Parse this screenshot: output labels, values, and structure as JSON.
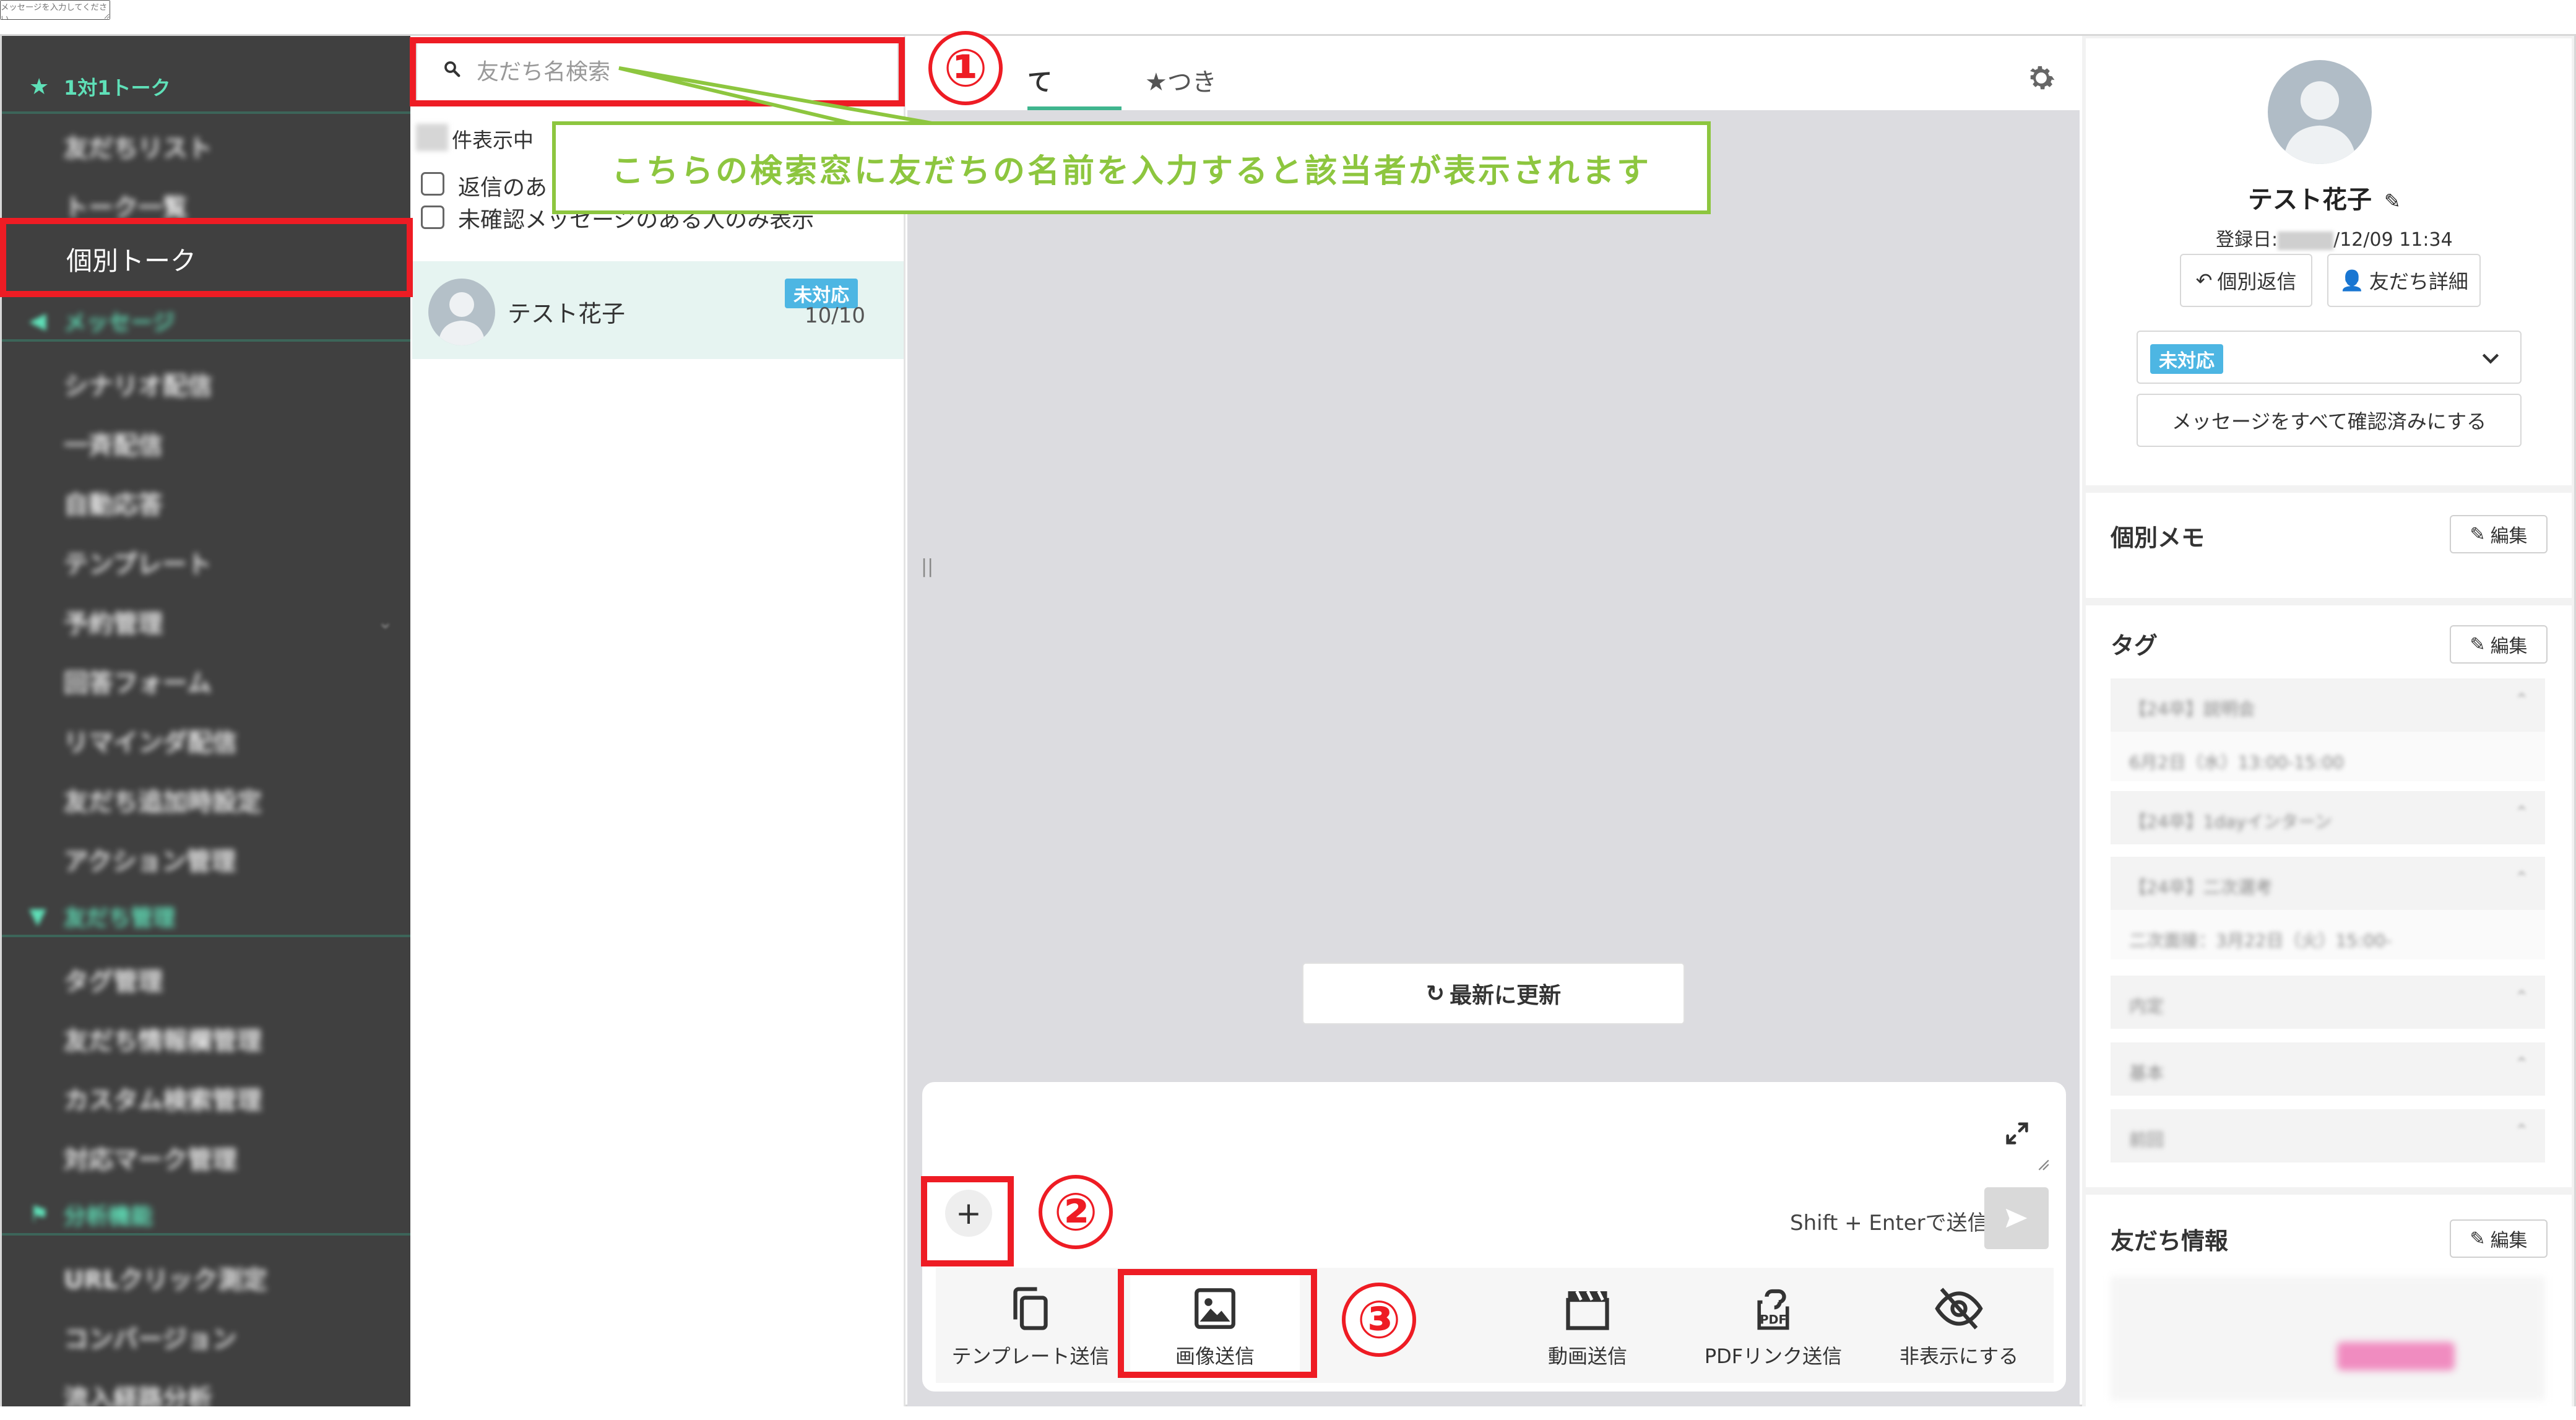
{
  "sidebar": {
    "section_1on1": "1対1トーク",
    "items": [
      "友だちリスト",
      "トーク一覧",
      "個別トーク"
    ],
    "section_message": "メッセージ",
    "message_items": [
      "シナリオ配信",
      "一斉配信",
      "自動応答",
      "テンプレート",
      "予約管理",
      "回答フォーム",
      "リマインダ配信",
      "友だち追加時設定",
      "アクション管理"
    ],
    "section_friends": "友だち管理",
    "friend_items": [
      "タグ管理",
      "友だち情報欄管理",
      "カスタム検索管理",
      "対応マーク管理"
    ],
    "section_analysis": "分析機能",
    "analysis_items": [
      "URLクリック測定",
      "コンバージョン",
      "流入経路分析"
    ]
  },
  "list": {
    "search_placeholder": "友だち名検索",
    "count_label": "件表示中",
    "filter_replied": "返信のあ",
    "filter_unread": "未確認メッセージのある人のみ表示",
    "friend": {
      "name": "テスト花子",
      "status": "未対応",
      "date": "10/10"
    }
  },
  "chat": {
    "tab_all": "て",
    "tab_starred": "★つき",
    "refresh_label": "最新に更新",
    "input_placeholder": "メッセージを入力してください",
    "shift_enter_hint": "Shift + Enterで送信",
    "plus_label": "+",
    "tools": [
      "テンプレート送信",
      "画像送信",
      "動画送信",
      "PDFリンク送信",
      "非表示にする"
    ]
  },
  "profile": {
    "name": "テスト花子",
    "registered_prefix": "登録日:",
    "registered_suffix": "/12/09 11:34",
    "reply_btn": "個別返信",
    "detail_btn": "友だち詳細",
    "status": "未対応",
    "mark_all_read": "メッセージをすべて確認済みにする",
    "memo_title": "個別メモ",
    "tag_title": "タグ",
    "friend_info_title": "友だち情報",
    "edit_label": "編集",
    "tags": [
      "【24卒】説明会",
      "6月2日（水）13:00-15:00",
      "【24卒】1dayインターン",
      "【24卒】二次選考",
      "二次面接：3月22日（火）15:00-",
      "内定",
      "基本",
      "前回"
    ]
  },
  "annotations": {
    "num1": "①",
    "num2": "②",
    "num3": "③",
    "callout_text": "こちらの検索窓に友だちの名前を入力すると該当者が表示されます",
    "annotation_color": "#ee1c24",
    "callout_color": "#8dc63f"
  }
}
